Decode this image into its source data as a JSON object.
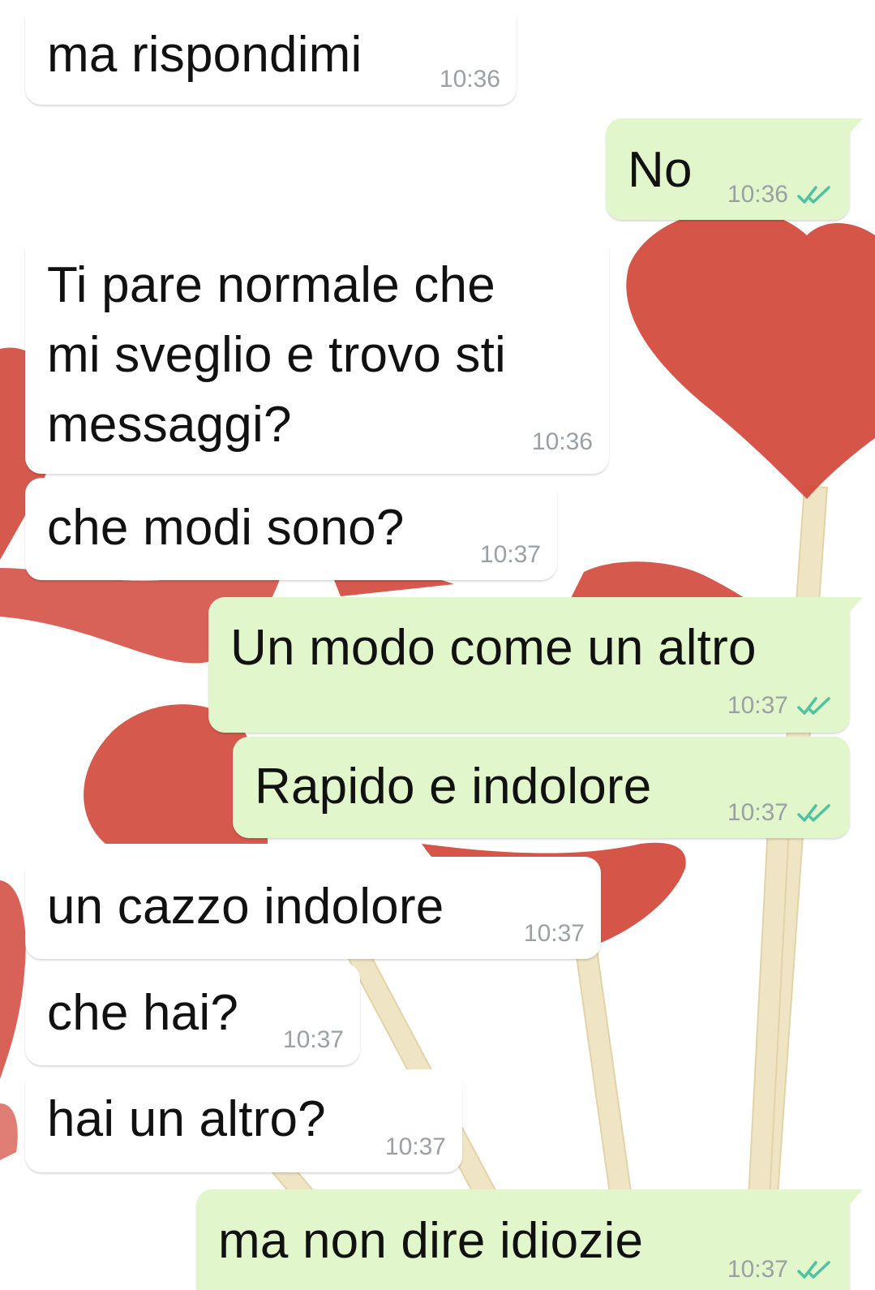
{
  "chat": {
    "colors": {
      "incoming_bubble": "#ffffff",
      "outgoing_bubble": "#e1f6cb",
      "timestamp": "#9aa0a4",
      "read_ticks": "#4fc3a1",
      "wallpaper_hearts": "#d1473a",
      "wallpaper_sticks": "#efe4c4"
    },
    "read_icon": "double-check-icon",
    "messages": [
      {
        "direction": "incoming",
        "text": "ma rispondimi",
        "time": "10:36"
      },
      {
        "direction": "outgoing",
        "text": "No",
        "time": "10:36",
        "status": "read"
      },
      {
        "direction": "incoming",
        "text": "Ti pare normale che\nmi sveglio e trovo sti\nmessaggi?",
        "time": "10:36"
      },
      {
        "direction": "incoming",
        "text": "che modi sono?",
        "time": "10:37"
      },
      {
        "direction": "outgoing",
        "text": "Un modo come un altro",
        "time": "10:37",
        "status": "read"
      },
      {
        "direction": "outgoing",
        "text": "Rapido e indolore",
        "time": "10:37",
        "status": "read"
      },
      {
        "direction": "incoming",
        "text": "un cazzo indolore",
        "time": "10:37"
      },
      {
        "direction": "incoming",
        "text": "che hai?",
        "time": "10:37"
      },
      {
        "direction": "incoming",
        "text": "hai un altro?",
        "time": "10:37"
      },
      {
        "direction": "outgoing",
        "text": "ma non dire idiozie",
        "time": "10:37",
        "status": "read"
      }
    ]
  }
}
